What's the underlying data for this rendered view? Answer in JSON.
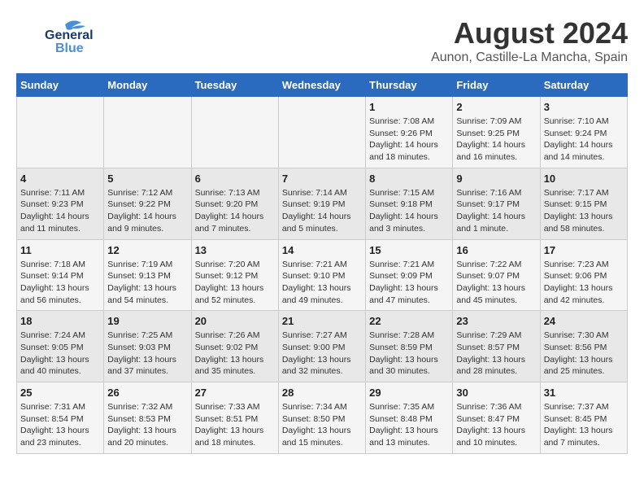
{
  "header": {
    "logo_line1": "General",
    "logo_line2": "Blue",
    "main_title": "August 2024",
    "sub_title": "Aunon, Castille-La Mancha, Spain"
  },
  "days_of_week": [
    "Sunday",
    "Monday",
    "Tuesday",
    "Wednesday",
    "Thursday",
    "Friday",
    "Saturday"
  ],
  "weeks": [
    [
      {
        "day": "",
        "info": ""
      },
      {
        "day": "",
        "info": ""
      },
      {
        "day": "",
        "info": ""
      },
      {
        "day": "",
        "info": ""
      },
      {
        "day": "1",
        "info": "Sunrise: 7:08 AM\nSunset: 9:26 PM\nDaylight: 14 hours\nand 18 minutes."
      },
      {
        "day": "2",
        "info": "Sunrise: 7:09 AM\nSunset: 9:25 PM\nDaylight: 14 hours\nand 16 minutes."
      },
      {
        "day": "3",
        "info": "Sunrise: 7:10 AM\nSunset: 9:24 PM\nDaylight: 14 hours\nand 14 minutes."
      }
    ],
    [
      {
        "day": "4",
        "info": "Sunrise: 7:11 AM\nSunset: 9:23 PM\nDaylight: 14 hours\nand 11 minutes."
      },
      {
        "day": "5",
        "info": "Sunrise: 7:12 AM\nSunset: 9:22 PM\nDaylight: 14 hours\nand 9 minutes."
      },
      {
        "day": "6",
        "info": "Sunrise: 7:13 AM\nSunset: 9:20 PM\nDaylight: 14 hours\nand 7 minutes."
      },
      {
        "day": "7",
        "info": "Sunrise: 7:14 AM\nSunset: 9:19 PM\nDaylight: 14 hours\nand 5 minutes."
      },
      {
        "day": "8",
        "info": "Sunrise: 7:15 AM\nSunset: 9:18 PM\nDaylight: 14 hours\nand 3 minutes."
      },
      {
        "day": "9",
        "info": "Sunrise: 7:16 AM\nSunset: 9:17 PM\nDaylight: 14 hours\nand 1 minute."
      },
      {
        "day": "10",
        "info": "Sunrise: 7:17 AM\nSunset: 9:15 PM\nDaylight: 13 hours\nand 58 minutes."
      }
    ],
    [
      {
        "day": "11",
        "info": "Sunrise: 7:18 AM\nSunset: 9:14 PM\nDaylight: 13 hours\nand 56 minutes."
      },
      {
        "day": "12",
        "info": "Sunrise: 7:19 AM\nSunset: 9:13 PM\nDaylight: 13 hours\nand 54 minutes."
      },
      {
        "day": "13",
        "info": "Sunrise: 7:20 AM\nSunset: 9:12 PM\nDaylight: 13 hours\nand 52 minutes."
      },
      {
        "day": "14",
        "info": "Sunrise: 7:21 AM\nSunset: 9:10 PM\nDaylight: 13 hours\nand 49 minutes."
      },
      {
        "day": "15",
        "info": "Sunrise: 7:21 AM\nSunset: 9:09 PM\nDaylight: 13 hours\nand 47 minutes."
      },
      {
        "day": "16",
        "info": "Sunrise: 7:22 AM\nSunset: 9:07 PM\nDaylight: 13 hours\nand 45 minutes."
      },
      {
        "day": "17",
        "info": "Sunrise: 7:23 AM\nSunset: 9:06 PM\nDaylight: 13 hours\nand 42 minutes."
      }
    ],
    [
      {
        "day": "18",
        "info": "Sunrise: 7:24 AM\nSunset: 9:05 PM\nDaylight: 13 hours\nand 40 minutes."
      },
      {
        "day": "19",
        "info": "Sunrise: 7:25 AM\nSunset: 9:03 PM\nDaylight: 13 hours\nand 37 minutes."
      },
      {
        "day": "20",
        "info": "Sunrise: 7:26 AM\nSunset: 9:02 PM\nDaylight: 13 hours\nand 35 minutes."
      },
      {
        "day": "21",
        "info": "Sunrise: 7:27 AM\nSunset: 9:00 PM\nDaylight: 13 hours\nand 32 minutes."
      },
      {
        "day": "22",
        "info": "Sunrise: 7:28 AM\nSunset: 8:59 PM\nDaylight: 13 hours\nand 30 minutes."
      },
      {
        "day": "23",
        "info": "Sunrise: 7:29 AM\nSunset: 8:57 PM\nDaylight: 13 hours\nand 28 minutes."
      },
      {
        "day": "24",
        "info": "Sunrise: 7:30 AM\nSunset: 8:56 PM\nDaylight: 13 hours\nand 25 minutes."
      }
    ],
    [
      {
        "day": "25",
        "info": "Sunrise: 7:31 AM\nSunset: 8:54 PM\nDaylight: 13 hours\nand 23 minutes."
      },
      {
        "day": "26",
        "info": "Sunrise: 7:32 AM\nSunset: 8:53 PM\nDaylight: 13 hours\nand 20 minutes."
      },
      {
        "day": "27",
        "info": "Sunrise: 7:33 AM\nSunset: 8:51 PM\nDaylight: 13 hours\nand 18 minutes."
      },
      {
        "day": "28",
        "info": "Sunrise: 7:34 AM\nSunset: 8:50 PM\nDaylight: 13 hours\nand 15 minutes."
      },
      {
        "day": "29",
        "info": "Sunrise: 7:35 AM\nSunset: 8:48 PM\nDaylight: 13 hours\nand 13 minutes."
      },
      {
        "day": "30",
        "info": "Sunrise: 7:36 AM\nSunset: 8:47 PM\nDaylight: 13 hours\nand 10 minutes."
      },
      {
        "day": "31",
        "info": "Sunrise: 7:37 AM\nSunset: 8:45 PM\nDaylight: 13 hours\nand 7 minutes."
      }
    ]
  ]
}
